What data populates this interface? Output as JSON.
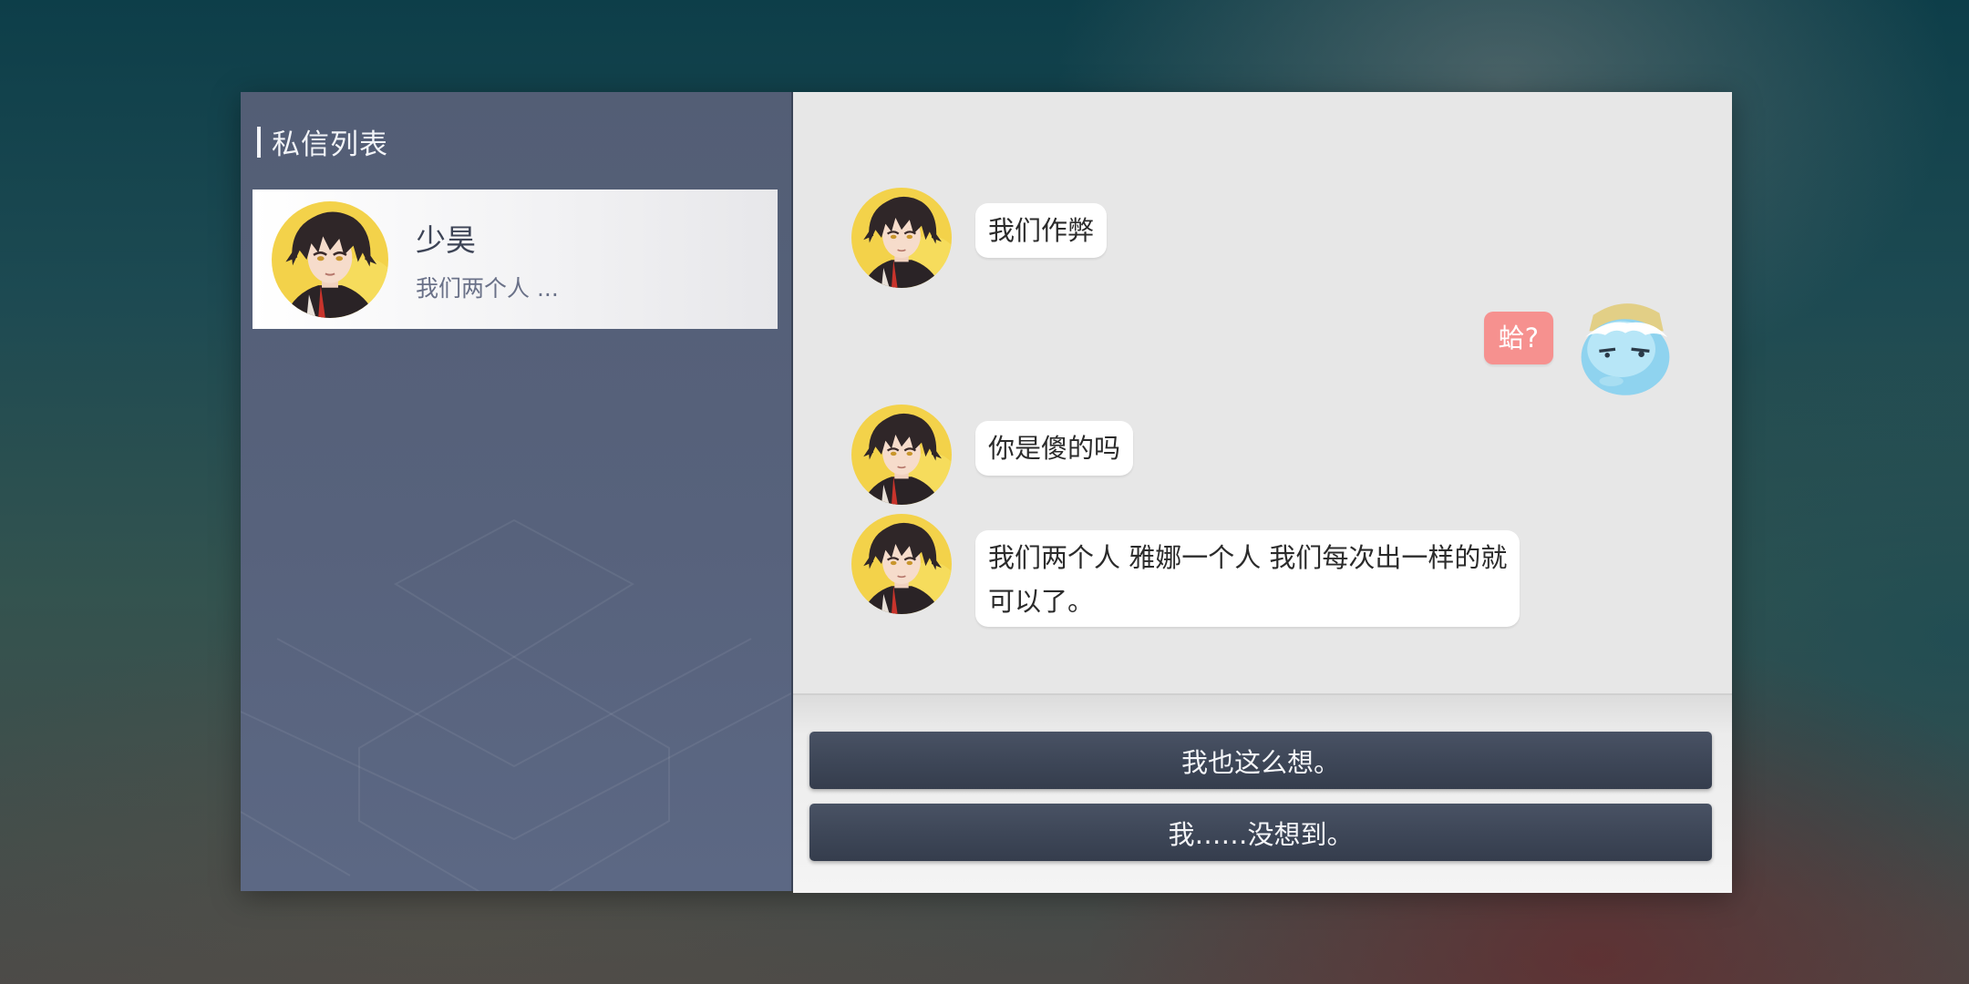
{
  "sidebar": {
    "title": "私信列表",
    "conversations": [
      {
        "name": "少昊",
        "preview": "我们两个人 ...",
        "avatar_icon": "dark-haired-boy-avatar"
      }
    ]
  },
  "chat": {
    "messages": [
      {
        "sender": "other",
        "text": "我们作弊",
        "avatar_icon": "dark-haired-boy-avatar"
      },
      {
        "sender": "me",
        "text": "蛤?",
        "avatar_icon": "blue-slime-avatar"
      },
      {
        "sender": "other",
        "text": "你是傻的吗",
        "avatar_icon": "dark-haired-boy-avatar"
      },
      {
        "sender": "other",
        "text_line1": "我们两个人 雅娜一个人 我们每次出一样的就",
        "text_line2": "可以了。",
        "avatar_icon": "dark-haired-boy-avatar"
      }
    ]
  },
  "options": [
    {
      "label": "我也这么想。"
    },
    {
      "label": "我……没想到。"
    }
  ],
  "colors": {
    "sidebar_bg": "#57627c",
    "chat_bg": "#e7e7e7",
    "my_bubble": "#f6918f",
    "option_button": "#3e4758"
  }
}
